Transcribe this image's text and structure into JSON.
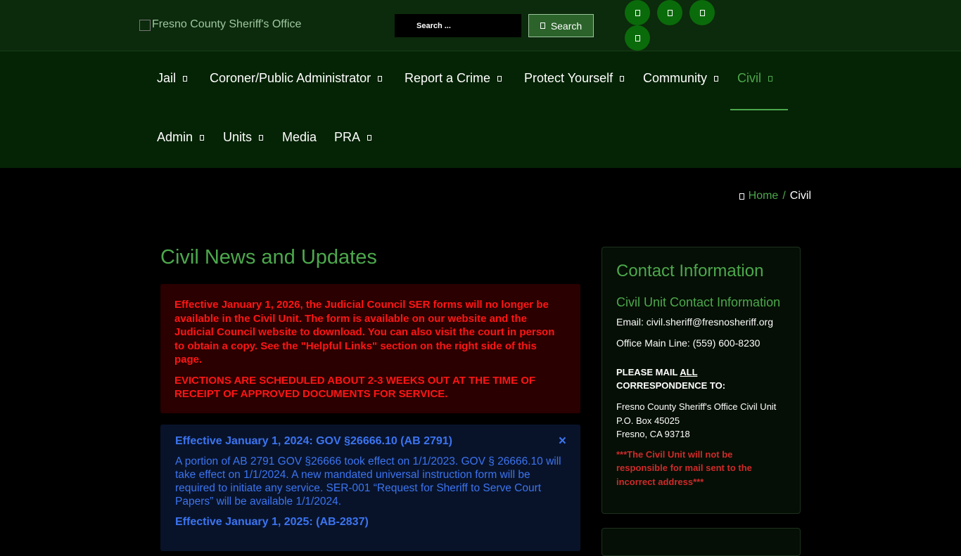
{
  "header": {
    "logo_alt": "Fresno County Sheriff's Office",
    "search_placeholder": "Search ...",
    "search_button": "Search"
  },
  "social": [
    "social-link-1",
    "social-link-2",
    "social-link-3",
    "social-link-4"
  ],
  "nav": {
    "items": [
      {
        "label": "Jail",
        "dropdown": true
      },
      {
        "label": "Coroner/Public Administrator",
        "dropdown": true
      },
      {
        "label": "Report a Crime",
        "dropdown": true
      },
      {
        "label": "Protect Yourself",
        "dropdown": true
      },
      {
        "label": "Community",
        "dropdown": true
      },
      {
        "label": "Civil",
        "dropdown": true,
        "active": true
      },
      {
        "label": "Admin",
        "dropdown": true
      },
      {
        "label": "Units",
        "dropdown": true
      },
      {
        "label": "Media",
        "dropdown": false
      },
      {
        "label": "PRA",
        "dropdown": true
      }
    ]
  },
  "breadcrumb": {
    "home": "Home",
    "separator": "/",
    "current": "Civil"
  },
  "main": {
    "title": "Civil News and Updates",
    "alert_red": {
      "p1": "Effective January 1, 2026, the Judicial Council SER forms will no longer be available in the Civil Unit. The form is available on our website and the Judicial Council website to download.  You can also visit the court in person to obtain a copy. See the \"Helpful Links\" section on the right side of this page.",
      "p2": "EVICTIONS ARE SCHEDULED ABOUT 2-3 WEEKS OUT AT THE TIME OF RECEIPT OF APPROVED DOCUMENTS FOR SERVICE."
    },
    "alert_blue": {
      "close": "×",
      "heading1": "Effective January 1, 2024: GOV §26666.10 (AB 2791)",
      "body1": "A portion of AB 2791 GOV §26666 took effect on 1/1/2023. GOV § 26666.10 will take effect on 1/1/2024. A new mandated universal instruction form will be required to initiate any service. SER-001 “Request for Sheriff to Serve Court Papers” will be available 1/1/2024.",
      "heading2": "Effective January 1, 2025: (AB-2837)"
    }
  },
  "sidebar": {
    "title": "Contact Information",
    "subtitle": "Civil Unit Contact Information",
    "email": "Email: civil.sheriff@fresnosheriff.org",
    "phone": "Office Main Line: (559) 600-8230",
    "mail_prefix": "PLEASE MAIL ",
    "mail_emph": "ALL",
    "mail_suffix": " CORRESPONDENCE TO:",
    "address": [
      "Fresno County Sheriff's Office Civil Unit",
      "P.O. Box 45025",
      "Fresno, CA 93718"
    ],
    "disclaimer": "***The Civil Unit will not be responsible for mail sent to the incorrect address***"
  },
  "colors": {
    "accent_green": "#4ca84c",
    "alert_red": "#ff1515",
    "alert_blue": "#3c74f0",
    "nav_bg": "#052305",
    "topbar_bg": "#0c2a0c"
  }
}
